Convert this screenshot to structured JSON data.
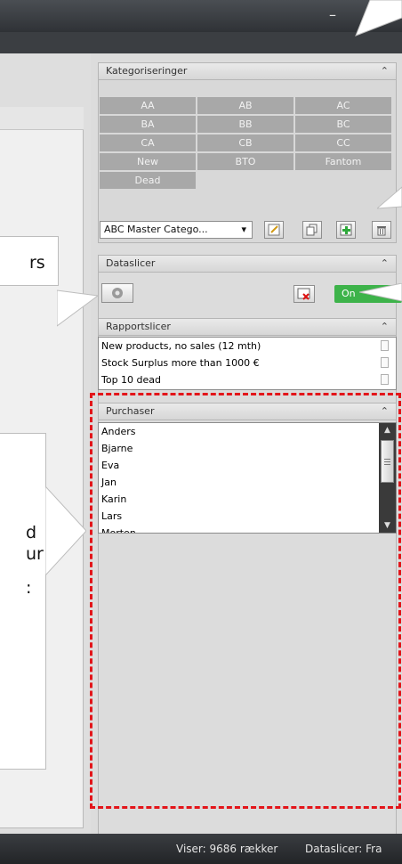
{
  "window": {
    "minimize_label": "–"
  },
  "kategoriseringer": {
    "title": "Kategoriseringer",
    "categories": [
      "AA",
      "AB",
      "AC",
      "BA",
      "BB",
      "BC",
      "CA",
      "CB",
      "CC",
      "New",
      "BTO",
      "Fantom",
      "Dead"
    ],
    "selected_category_set": "ABC Master Catego...",
    "dropdown_arrow": "▾",
    "tools": [
      "edit",
      "copy",
      "add",
      "delete"
    ]
  },
  "dataslicer": {
    "title": "Dataslicer",
    "toggle_label": "On"
  },
  "rapportslicer": {
    "title": "Rapportslicer",
    "items": [
      "New products, no sales (12 mth)",
      "Stock Surplus more than 1000 €",
      "Top 10 dead"
    ]
  },
  "purchaser": {
    "title": "Purchaser",
    "items": [
      "Anders",
      "Bjarne",
      "Eva",
      "Jan",
      "Karin",
      "Lars",
      "Morten"
    ]
  },
  "callouts": {
    "left_top_fragment": "rs",
    "left_middle_fragments": [
      "d",
      "ur",
      ":"
    ]
  },
  "status": {
    "rows_text": "Viser: 9686 rækker",
    "dataslicer_text": "Dataslicer: Fra"
  },
  "colors": {
    "toggle_green": "#3db34a",
    "dashed_red": "#e3151a",
    "accent_gray": "#a8a8a8"
  }
}
